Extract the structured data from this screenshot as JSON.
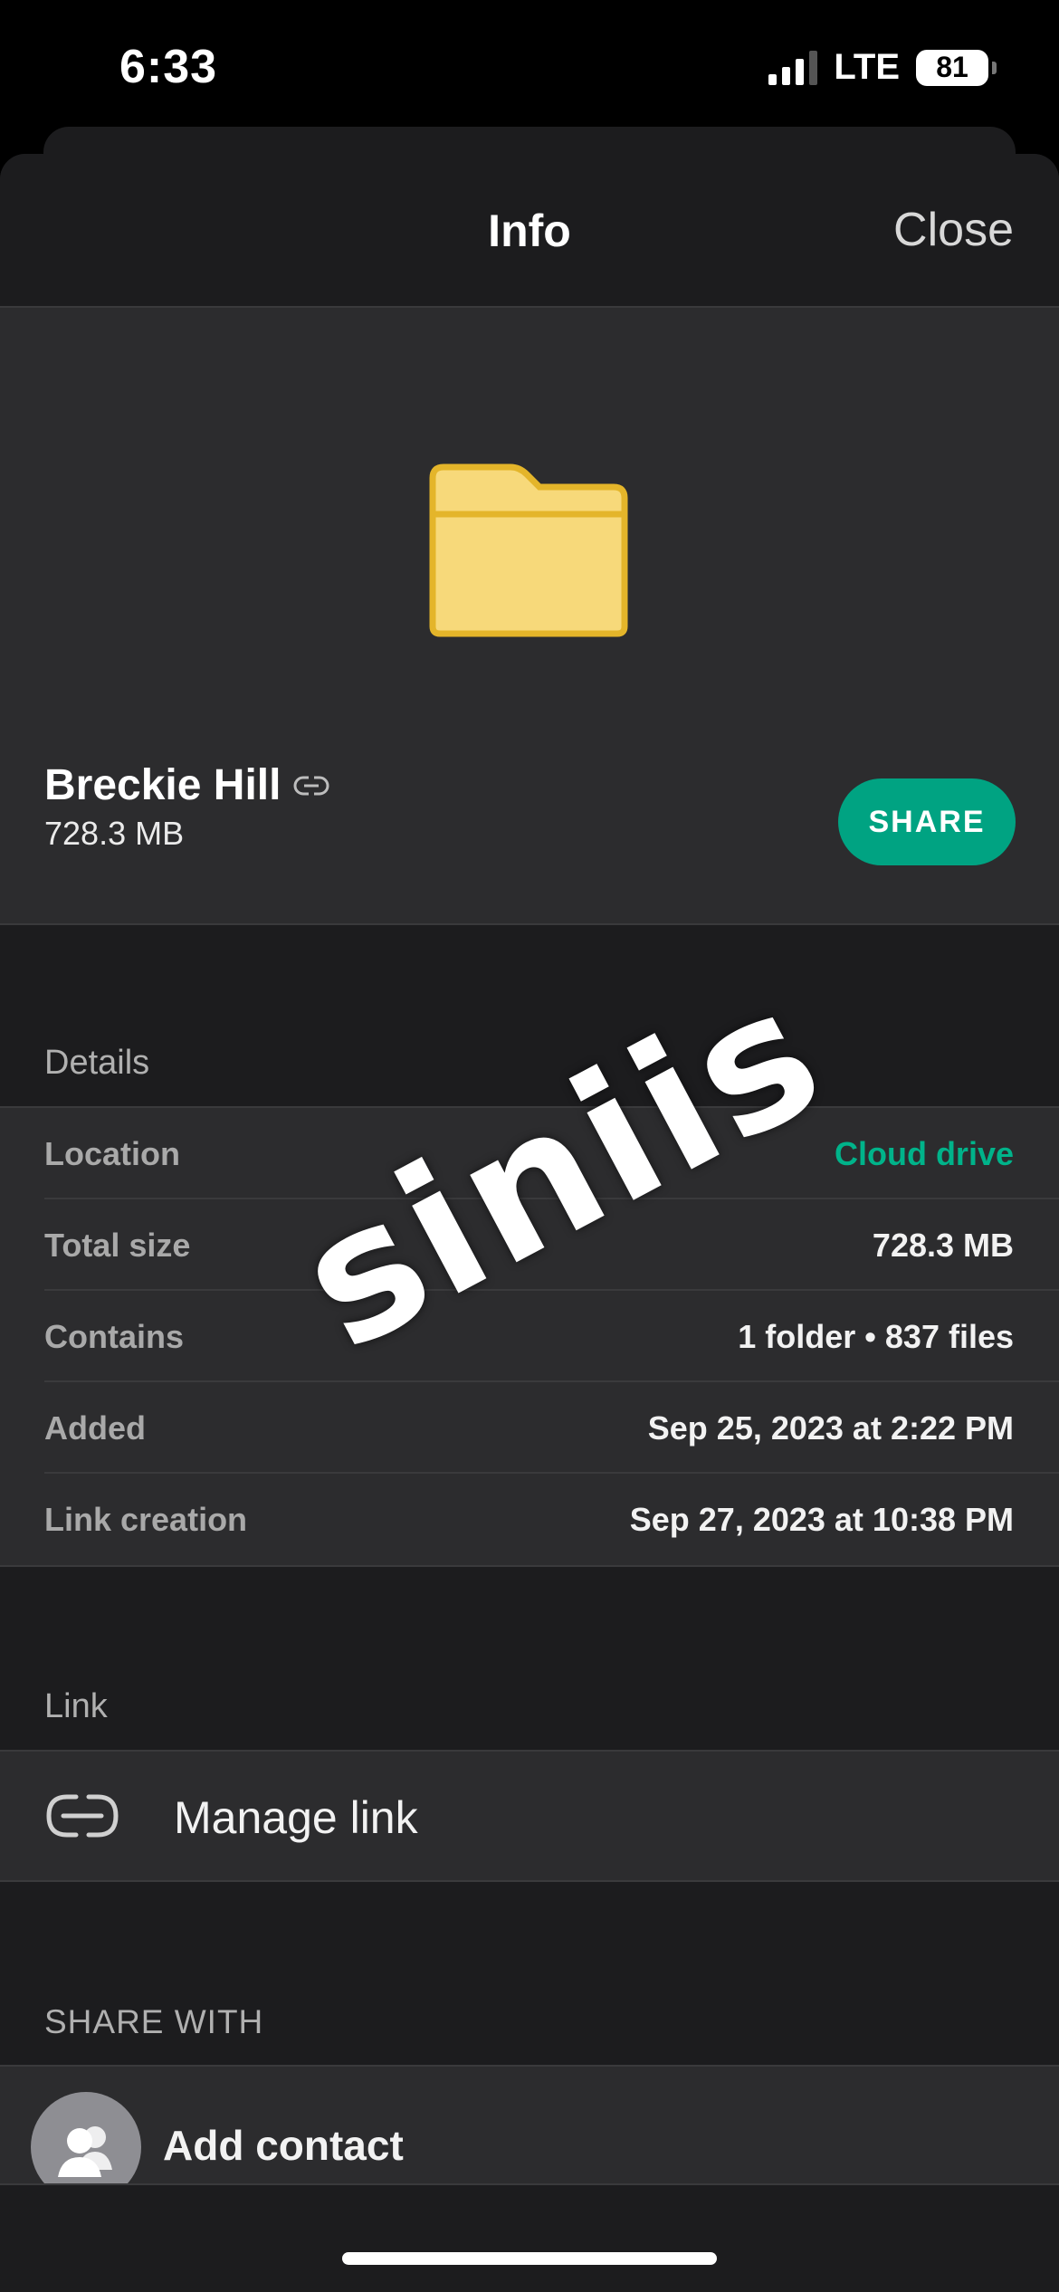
{
  "status_bar": {
    "time": "6:33",
    "network": "LTE",
    "battery": "81"
  },
  "header": {
    "title": "Info",
    "close_label": "Close"
  },
  "item": {
    "name": "Breckie Hill",
    "size": "728.3 MB",
    "share_label": "SHARE"
  },
  "details": {
    "section_label": "Details",
    "rows": [
      {
        "key": "Location",
        "value": "Cloud drive"
      },
      {
        "key": "Total size",
        "value": "728.3 MB"
      },
      {
        "key": "Contains",
        "value": "1 folder • 837 files"
      },
      {
        "key": "Added",
        "value": "Sep 25, 2023 at 2:22 PM"
      },
      {
        "key": "Link creation",
        "value": "Sep 27, 2023 at 10:38 PM"
      }
    ]
  },
  "link_section": {
    "section_label": "Link",
    "manage_label": "Manage link"
  },
  "share_section": {
    "section_label": "SHARE WITH",
    "add_contact_label": "Add contact"
  },
  "watermark": "siniis",
  "colors": {
    "accent": "#00a382",
    "folder": "#f7d97a",
    "folder_stroke": "#e4b52a",
    "background": "#1c1c1e",
    "card": "#2c2c2e"
  }
}
